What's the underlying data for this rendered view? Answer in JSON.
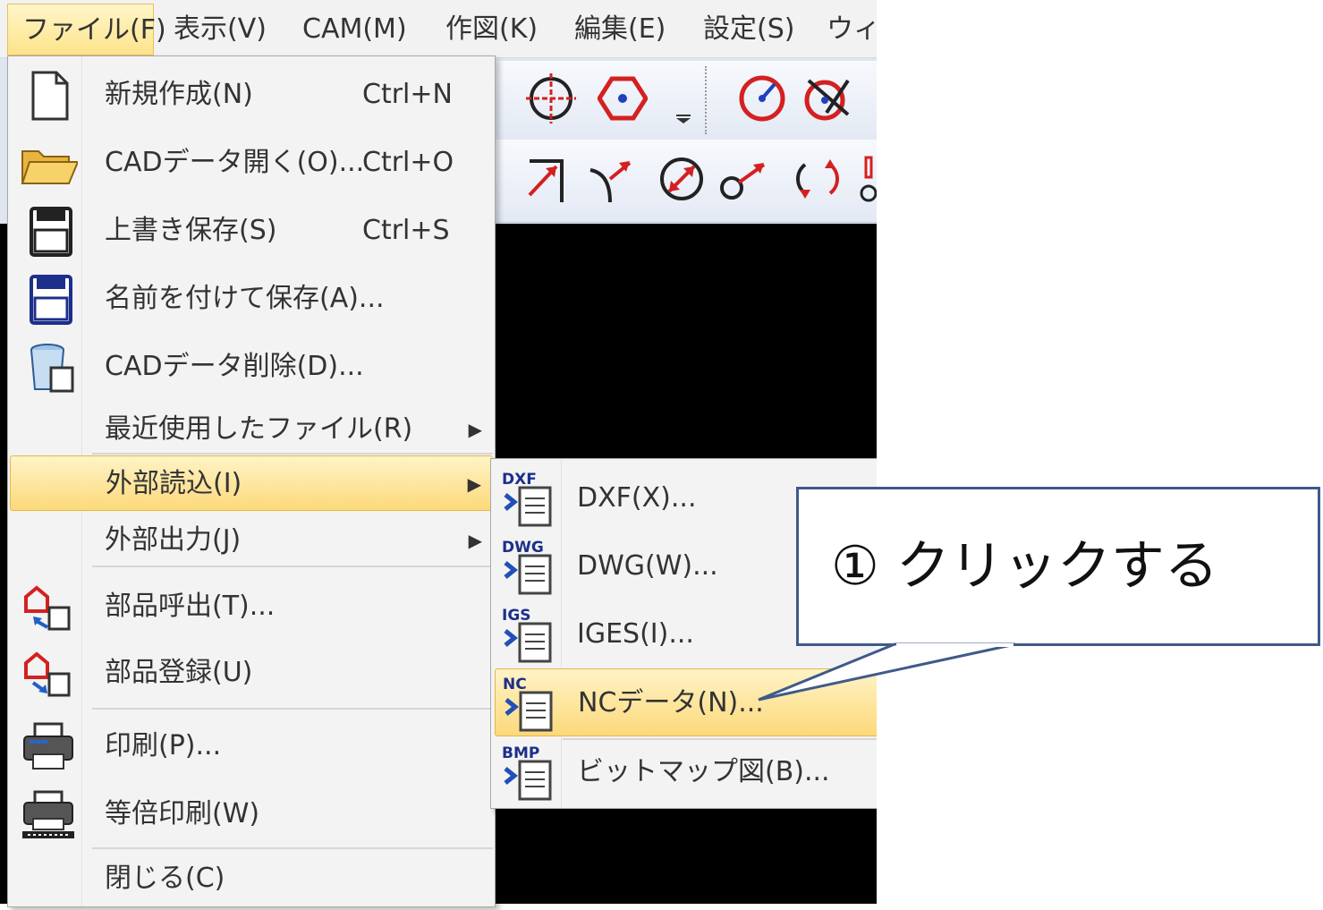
{
  "menubar": {
    "items": [
      {
        "label": "ファイル(F)"
      },
      {
        "label": "表示(V)"
      },
      {
        "label": "CAM(M)"
      },
      {
        "label": "作図(K)"
      },
      {
        "label": "編集(E)"
      },
      {
        "label": "設定(S)"
      },
      {
        "label": "ウィン"
      }
    ]
  },
  "file_menu": {
    "items": [
      {
        "label": "新規作成(N)",
        "shortcut": "Ctrl+N",
        "icon": "new-document-icon"
      },
      {
        "label": "CADデータ開く(O)...",
        "shortcut": "Ctrl+O",
        "icon": "open-folder-icon"
      },
      {
        "label": "上書き保存(S)",
        "shortcut": "Ctrl+S",
        "icon": "save-icon"
      },
      {
        "label": "名前を付けて保存(A)...",
        "shortcut": "",
        "icon": "save-as-icon"
      },
      {
        "label": "CADデータ削除(D)...",
        "shortcut": "",
        "icon": "delete-data-icon"
      },
      {
        "label": "最近使用したファイル(R)",
        "shortcut": "",
        "icon": ""
      },
      {
        "label": "外部読込(I)",
        "shortcut": "",
        "icon": ""
      },
      {
        "label": "外部出力(J)",
        "shortcut": "",
        "icon": ""
      },
      {
        "label": "部品呼出(T)...",
        "shortcut": "",
        "icon": "part-load-icon"
      },
      {
        "label": "部品登録(U)",
        "shortcut": "",
        "icon": "part-register-icon"
      },
      {
        "label": "印刷(P)...",
        "shortcut": "",
        "icon": "printer-icon"
      },
      {
        "label": "等倍印刷(W)",
        "shortcut": "",
        "icon": "printer-scale-icon"
      },
      {
        "label": "閉じる(C)",
        "shortcut": "",
        "icon": ""
      }
    ]
  },
  "import_submenu": {
    "items": [
      {
        "label": "DXF(X)...",
        "badge": "DXF"
      },
      {
        "label": "DWG(W)...",
        "badge": "DWG"
      },
      {
        "label": "IGES(I)...",
        "badge": "IGS"
      },
      {
        "label": "NCデータ(N)...",
        "badge": "NC"
      },
      {
        "label": "ビットマップ図(B)...",
        "badge": "BMP"
      }
    ]
  },
  "callout": {
    "text": "① クリックする"
  },
  "colors": {
    "highlight": "#fcd97a",
    "callout_border": "#3f5a8a",
    "canvas": "#000000",
    "icon_red": "#d42020"
  }
}
